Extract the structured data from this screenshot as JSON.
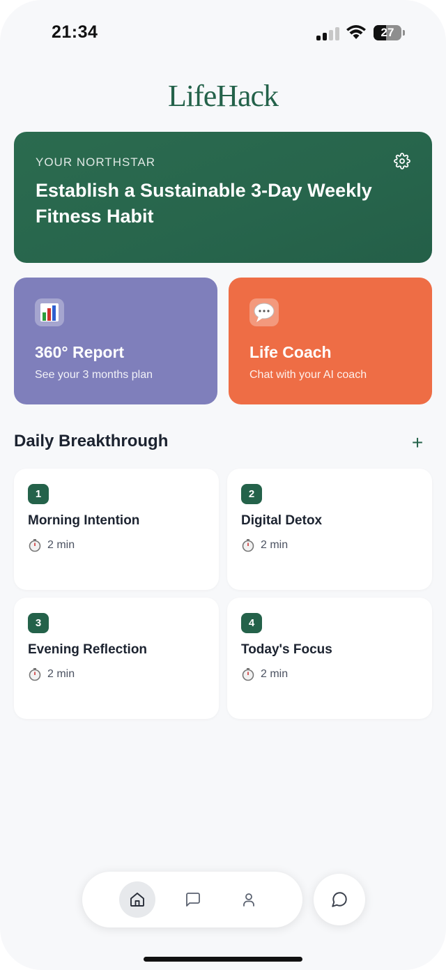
{
  "status_bar": {
    "time": "21:34",
    "battery": "27"
  },
  "app": {
    "logo": "LifeHack",
    "brand_color": "#24624a"
  },
  "northstar": {
    "label": "YOUR NORTHSTAR",
    "title": "Establish a Sustainable 3-Day Weekly Fitness Habit",
    "settings_icon": "gear-icon"
  },
  "features": [
    {
      "icon": "bar-chart-icon",
      "title": "360° Report",
      "subtitle": "See your 3 months plan",
      "color": "#7f7fbb"
    },
    {
      "icon": "speech-bubble-icon",
      "title": "Life Coach",
      "subtitle": "Chat with your AI coach",
      "color": "#ee6d45"
    }
  ],
  "daily": {
    "title": "Daily Breakthrough",
    "add_icon": "plus-icon",
    "add_symbol": "+",
    "tasks": [
      {
        "num": "1",
        "title": "Morning Intention",
        "time": "2 min"
      },
      {
        "num": "2",
        "title": "Digital Detox",
        "time": "2 min"
      },
      {
        "num": "3",
        "title": "Evening Reflection",
        "time": "2 min"
      },
      {
        "num": "4",
        "title": "Today's Focus",
        "time": "2 min"
      }
    ]
  },
  "nav": {
    "items": [
      {
        "icon": "home-icon",
        "active": true
      },
      {
        "icon": "message-square-icon",
        "active": false
      },
      {
        "icon": "user-icon",
        "active": false
      }
    ],
    "fab_icon": "chat-bubble-icon"
  }
}
